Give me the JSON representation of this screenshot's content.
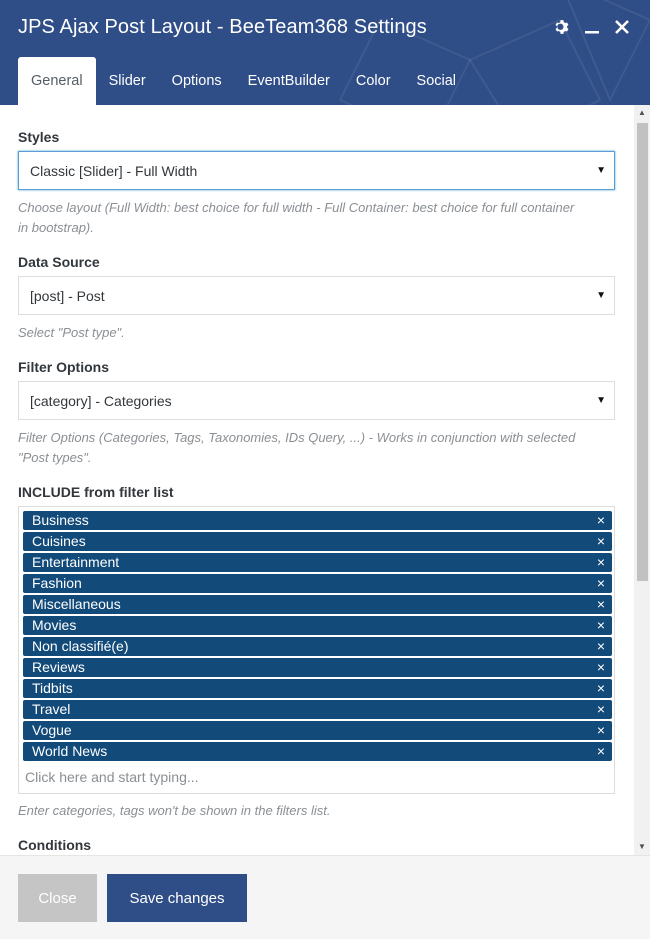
{
  "window": {
    "title": "JPS Ajax Post Layout - BeeTeam368 Settings",
    "icons": [
      "gear-icon",
      "minimize-icon",
      "close-icon"
    ]
  },
  "tabs": [
    {
      "label": "General",
      "active": true
    },
    {
      "label": "Slider"
    },
    {
      "label": "Options"
    },
    {
      "label": "EventBuilder"
    },
    {
      "label": "Color"
    },
    {
      "label": "Social"
    }
  ],
  "form": {
    "styles": {
      "label": "Styles",
      "value": "Classic [Slider] - Full Width",
      "help_line1": "Choose layout (Full Width: best choice for full width - Full Container: best choice for full container",
      "help_line2": "in bootstrap)."
    },
    "data_source": {
      "label": "Data Source",
      "value": "[post] - Post",
      "help": "Select \"Post type\"."
    },
    "filter_options": {
      "label": "Filter Options",
      "value": "[category] - Categories",
      "help_line1": "Filter Options (Categories, Tags, Taxonomies, IDs Query, ...) - Works in conjunction with selected",
      "help_line2": "\"Post types\"."
    },
    "include": {
      "label": "INCLUDE from filter list",
      "tags": [
        "Business",
        "Cuisines",
        "Entertainment",
        "Fashion",
        "Miscellaneous",
        "Movies",
        "Non classifié(e)",
        "Reviews",
        "Tidbits",
        "Travel",
        "Vogue",
        "World News"
      ],
      "remove_symbol": "×",
      "placeholder": "Click here and start typing...",
      "help": "Enter categories, tags won't be shown in the filters list."
    },
    "conditions": {
      "label": "Conditions"
    }
  },
  "footer": {
    "close_label": "Close",
    "save_label": "Save changes"
  },
  "colors": {
    "header": "#2f4d86",
    "tag": "#124a7a",
    "save_button": "#2f4d86",
    "close_button": "#c5c5c5"
  }
}
